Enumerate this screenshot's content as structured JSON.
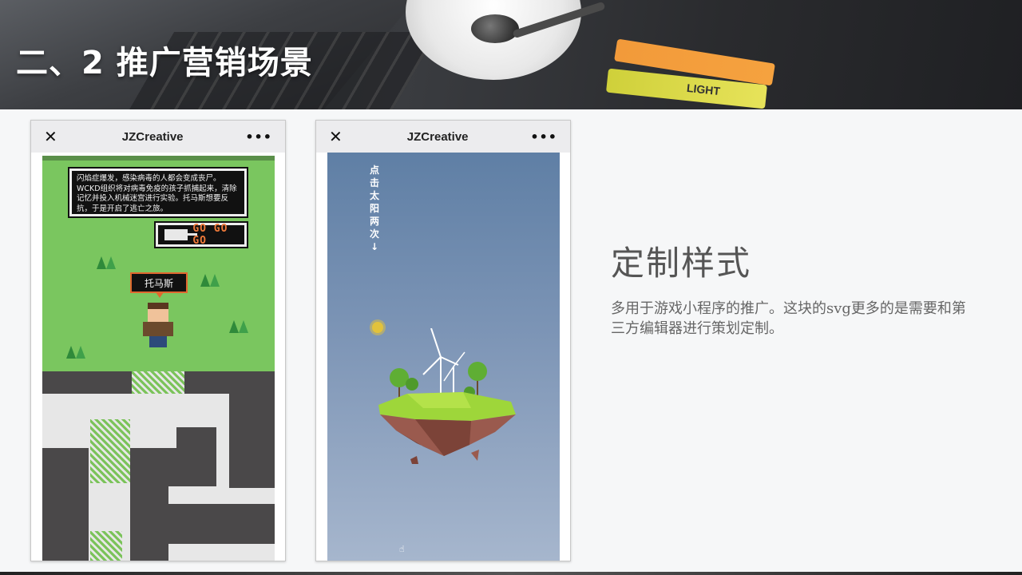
{
  "slide": {
    "title": "二、2  推广营销场景",
    "banner_text": "LIGHT"
  },
  "phone1": {
    "close_icon": "close-icon",
    "title": "JZCreative",
    "more": "•••",
    "dialog": "闪焰症爆发，感染病毒的人都会变成丧尸。WCKD组织将对病毒免疫的孩子抓捕起来，清除记忆并投入机械迷宫进行实验。托马斯想要反抗，于是开启了逃亡之旅。",
    "go_label": "GO GO GO",
    "name_tag": "托马斯"
  },
  "phone2": {
    "close_icon": "close-icon",
    "title": "JZCreative",
    "more": "•••",
    "vertical_text": "点击太阳两次↓"
  },
  "content": {
    "heading": "定制样式",
    "description": "多用于游戏小程序的推广。这块的svg更多的是需要和第三方编辑器进行策划定制。"
  },
  "colors": {
    "grass": "#7ac65f",
    "maze_wall": "#4a4849",
    "sky_top": "#5f7fa5",
    "sky_bottom": "#a6b6cd",
    "accent_orange": "#e0672f"
  }
}
